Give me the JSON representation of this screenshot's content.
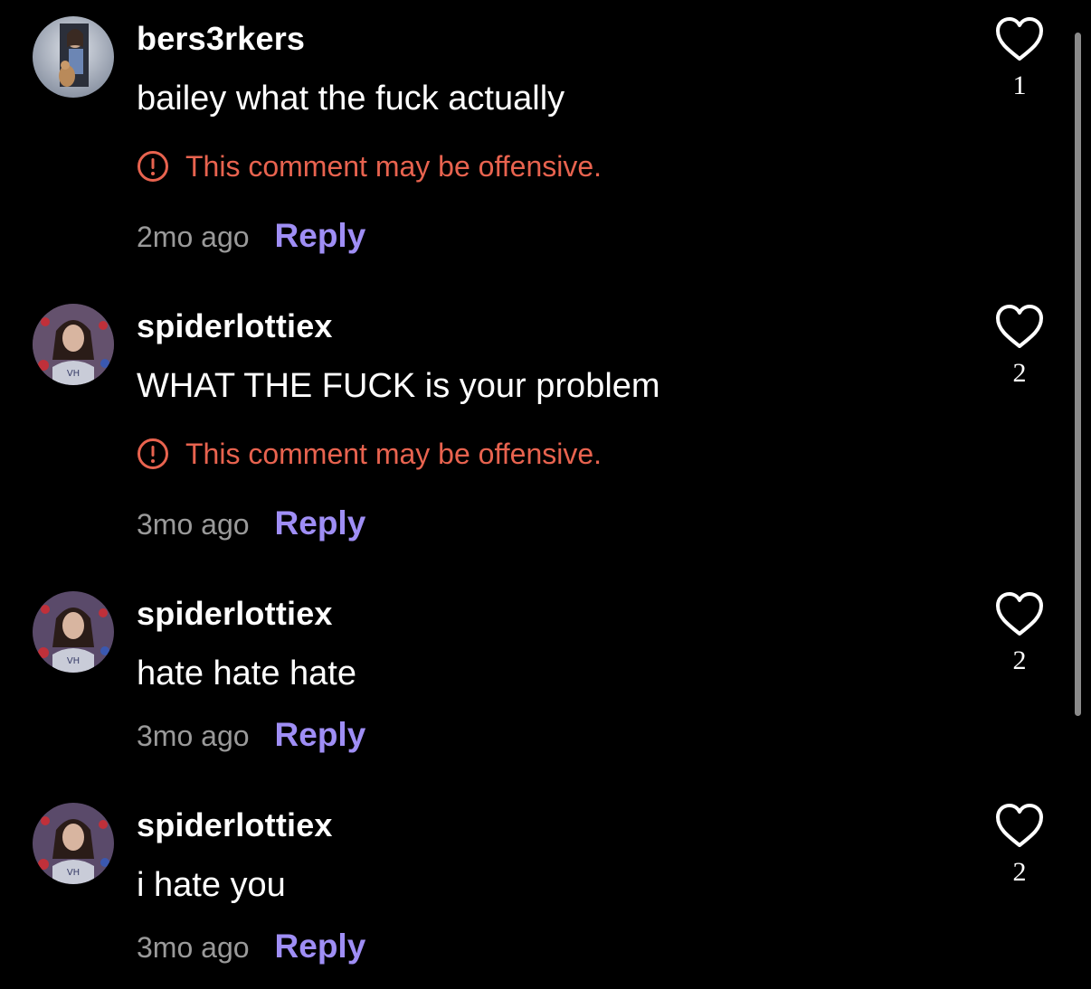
{
  "comments": [
    {
      "username": "bers3rkers",
      "text": "bailey what the fuck actually",
      "warning": "This comment may be offensive.",
      "timestamp": "2mo ago",
      "reply_label": "Reply",
      "likes": "1",
      "avatar": "avatar-dog-portrait"
    },
    {
      "username": "spiderlottiex",
      "text": "WHAT THE FUCK is your problem",
      "warning": "This comment may be offensive.",
      "timestamp": "3mo ago",
      "reply_label": "Reply",
      "likes": "2",
      "avatar": "avatar-person-portrait"
    },
    {
      "username": "spiderlottiex",
      "text": "hate hate hate",
      "timestamp": "3mo ago",
      "reply_label": "Reply",
      "likes": "2",
      "avatar": "avatar-person-portrait"
    },
    {
      "username": "spiderlottiex",
      "text": "i hate you",
      "timestamp": "3mo ago",
      "reply_label": "Reply",
      "likes": "2",
      "avatar": "avatar-person-portrait"
    }
  ],
  "icons": {
    "warning": "alert-circle-icon",
    "like": "heart-outline-icon"
  },
  "colors": {
    "background": "#000000",
    "warning": "#e8634f",
    "reply": "#9f8ef5",
    "timestamp": "#9a9a9a"
  }
}
